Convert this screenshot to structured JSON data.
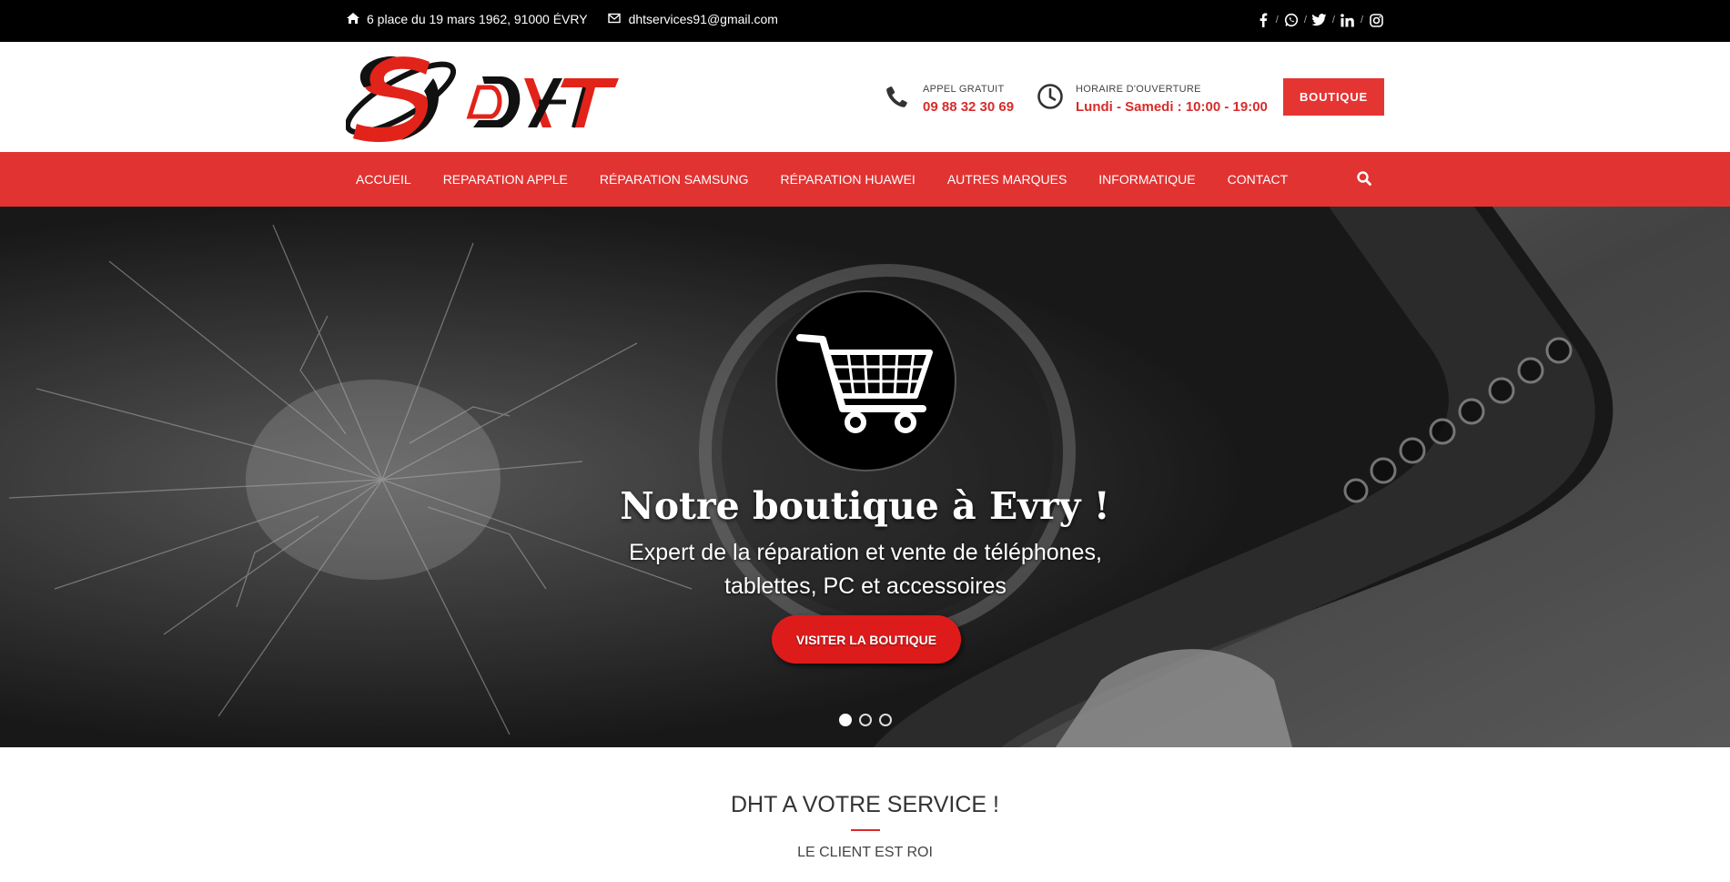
{
  "topbar": {
    "address": "6 place du 19 mars 1962, 91000 ÉVRY",
    "email": "dhtservices91@gmail.com",
    "social": [
      "facebook-icon",
      "whatsapp-icon",
      "twitter-icon",
      "linkedin-icon",
      "instagram-icon"
    ],
    "separator": "/"
  },
  "header": {
    "logo_text": "DHT",
    "call": {
      "label": "APPEL GRATUIT",
      "value": "09 88 32 30 69"
    },
    "hours": {
      "label": "HORAIRE D'OUVERTURE",
      "value": "Lundi - Samedi : 10:00 - 19:00"
    },
    "boutique_button": "BOUTIQUE"
  },
  "nav": {
    "items": [
      "ACCUEIL",
      "REPARATION APPLE",
      "RÉPARATION SAMSUNG",
      "RÉPARATION HUAWEI",
      "AUTRES MARQUES",
      "INFORMATIQUE",
      "CONTACT"
    ]
  },
  "hero": {
    "title": "Notre boutique à Evry !",
    "subtitle": "Expert de la réparation et vente de téléphones, tablettes, PC et accessoires",
    "button": "VISITER LA BOUTIQUE",
    "slides": 3,
    "active_slide": 1
  },
  "service": {
    "title": "DHT A VOTRE SERVICE !",
    "subtitle": "LE CLIENT EST ROI"
  },
  "colors": {
    "accent": "#e13332",
    "topbar": "#000000",
    "price_red": "#d92b2b"
  }
}
